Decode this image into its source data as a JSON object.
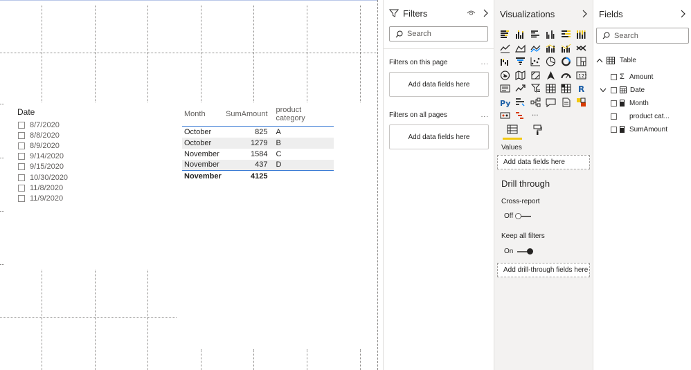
{
  "slicer": {
    "title": "Date",
    "items": [
      "8/7/2020",
      "8/8/2020",
      "8/9/2020",
      "9/14/2020",
      "9/15/2020",
      "10/30/2020",
      "11/8/2020",
      "11/9/2020"
    ]
  },
  "table": {
    "headers": [
      "Month",
      "SumAmount",
      "product category"
    ],
    "rows": [
      [
        "October",
        "825",
        "A"
      ],
      [
        "October",
        "1279",
        "B"
      ],
      [
        "November",
        "1584",
        "C"
      ],
      [
        "November",
        "437",
        "D"
      ]
    ],
    "total": [
      "November",
      "4125",
      ""
    ]
  },
  "filters": {
    "title": "Filters",
    "search_placeholder": "Search",
    "on_this_page": "Filters on this page",
    "on_all_pages": "Filters on all pages",
    "add_fields": "Add data fields here",
    "more": "..."
  },
  "viz": {
    "title": "Visualizations",
    "values_label": "Values",
    "add_fields": "Add data fields here",
    "drill_title": "Drill through",
    "cross_report": "Cross-report",
    "cross_state": "Off",
    "keep_filters": "Keep all filters",
    "keep_state": "On",
    "add_drill": "Add drill-through fields here",
    "more": "···",
    "r_label": "R",
    "py_label": "Py"
  },
  "fields": {
    "title": "Fields",
    "search_placeholder": "Search",
    "table_name": "Table",
    "items": [
      "Amount",
      "Date",
      "Month",
      "product cat...",
      "SumAmount"
    ],
    "sigma": "Σ"
  },
  "colors": {
    "accent_blue": "#3a7bd5",
    "format_underline": "#f2c811",
    "pane_bg": "#f3f2f1"
  }
}
